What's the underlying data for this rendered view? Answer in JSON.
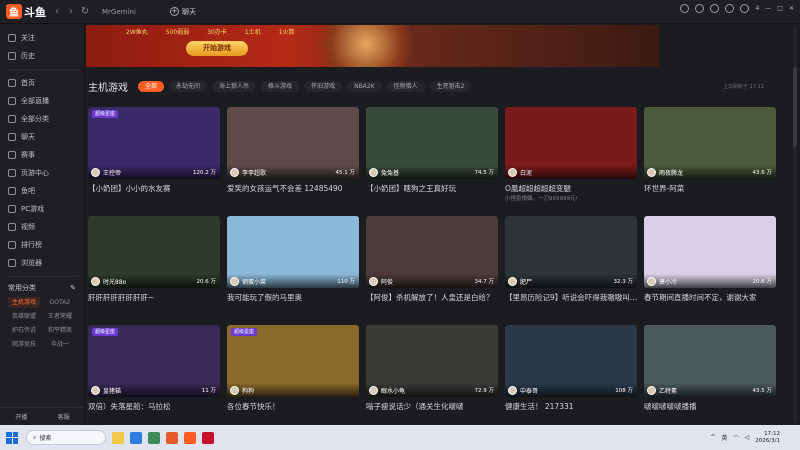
{
  "topbar": {
    "logo_text": "斗鱼",
    "site_title": "MrGemini",
    "tab_label": "聊天",
    "right_items": [
      "4"
    ]
  },
  "sidebar": {
    "items": [
      {
        "label": "关注",
        "icon": "heart-icon"
      },
      {
        "label": "历史",
        "icon": "history-icon"
      },
      {
        "label": "首页",
        "icon": "home-icon"
      },
      {
        "label": "全部直播",
        "icon": "live-icon"
      },
      {
        "label": "全部分类",
        "icon": "category-icon"
      },
      {
        "label": "聊天",
        "icon": "chat-icon"
      },
      {
        "label": "赛事",
        "icon": "trophy-icon"
      },
      {
        "label": "页游中心",
        "icon": "game-icon"
      },
      {
        "label": "鱼吧",
        "icon": "forum-icon"
      },
      {
        "label": "PC游戏",
        "icon": "pc-icon"
      },
      {
        "label": "视频",
        "icon": "video-icon"
      },
      {
        "label": "排行榜",
        "icon": "rank-icon"
      },
      {
        "label": "浏览器",
        "icon": "browser-icon"
      }
    ],
    "category_header": "常用分类",
    "categories": [
      "主机游戏",
      "DOTA2",
      "英雄联盟",
      "王者荣耀",
      "炉石传说",
      "和平精英",
      "网游竞技",
      "伞战一"
    ],
    "bottom": [
      "开播",
      "客服"
    ]
  },
  "banner": {
    "items": [
      "2W鱼丸",
      "500弱弱",
      "30办卡",
      "1土机",
      "1火箭"
    ],
    "button_label": "开始游戏"
  },
  "section": {
    "title": "主机游戏",
    "filters": [
      "全部",
      "永劫无间",
      "海上狼人杀",
      "格斗游戏",
      "怀旧游戏",
      "NBA2K",
      "怪物猎人",
      "生死狙击2"
    ],
    "updated": "上次刷新于 17:11"
  },
  "cards": [
    {
      "streamer": "王控帝",
      "viewers": "120.2 万",
      "title": "【小奶团】小小的水友赛",
      "sub": "",
      "tag": "超级星座",
      "bg": "#3b2a6a"
    },
    {
      "streamer": "李李超歌",
      "viewers": "45.1 万",
      "title": "爱笑的女孩运气不会差 12485490",
      "sub": "",
      "tag": "",
      "bg": "#5e4a4a"
    },
    {
      "streamer": "兔兔基",
      "viewers": "74.5 万",
      "title": "【小奶团】瞎狗之王真好玩",
      "sub": "",
      "tag": "",
      "bg": "#3a4a3a"
    },
    {
      "streamer": "白泥",
      "viewers": "",
      "title": "O凰超超超超超变腿",
      "sub": "小怪兽傀儡，一刀999999元!",
      "tag": "",
      "bg": "#7a1a1a"
    },
    {
      "streamer": "雨夜腾龙",
      "viewers": "43.6 万",
      "title": "环世界-阿菜",
      "sub": "",
      "tag": "",
      "bg": "#4a5a3a"
    },
    {
      "streamer": "时光88o",
      "viewers": "20.6 万",
      "title": "肝肝肝肝肝肝肝肝~",
      "sub": "",
      "tag": "",
      "bg": "#2e3a2a"
    },
    {
      "streamer": "钢蛋小菜",
      "viewers": "110 万",
      "title": "我可能玩了假的马里奥",
      "sub": "",
      "tag": "",
      "bg": "#8ab8d8"
    },
    {
      "streamer": "阿俊",
      "viewers": "34.7 万",
      "title": "【阿俊】杀机解放了！人皇还是白给？",
      "sub": "",
      "tag": "",
      "bg": "#4a3a3a"
    },
    {
      "streamer": "肥尸",
      "viewers": "32.3 万",
      "title": "【里昂历险记9】听说会吓得我嗷嗷叫…",
      "sub": "",
      "tag": "",
      "bg": "#2e3336"
    },
    {
      "streamer": "萧小冷",
      "viewers": "20.6 万",
      "title": "春节期间直播时间不定，谢谢大家",
      "sub": "",
      "tag": "",
      "bg": "#d8d0e8"
    },
    {
      "streamer": "皇猪猫",
      "viewers": "11 万",
      "title": "双倍）失落星船：马拉松",
      "sub": "",
      "tag": "超级星座",
      "bg": "#3a2a5a"
    },
    {
      "streamer": "狗狗",
      "viewers": "",
      "title": "各位春节快乐！",
      "sub": "",
      "tag": "超级星座",
      "bg": "#8a6a2a"
    },
    {
      "streamer": "眼水小龟",
      "viewers": "72.9 万",
      "title": "嗡子瘦说话少（通关生化啵啵",
      "sub": "",
      "tag": "",
      "bg": "#3a3a36"
    },
    {
      "streamer": "中泰哥",
      "viewers": "108 万",
      "title": "健康生活！ 217331",
      "sub": "",
      "tag": "",
      "bg": "#2a3a4a"
    },
    {
      "streamer": "乙特素",
      "viewers": "43.5 万",
      "title": "啵啵啵啵啵播播",
      "sub": "",
      "tag": "",
      "bg": "#4a5a5a"
    }
  ],
  "taskbar": {
    "search_label": "搜索",
    "tray_lang": "英",
    "time": "17:12",
    "date": "2026/3/1"
  }
}
